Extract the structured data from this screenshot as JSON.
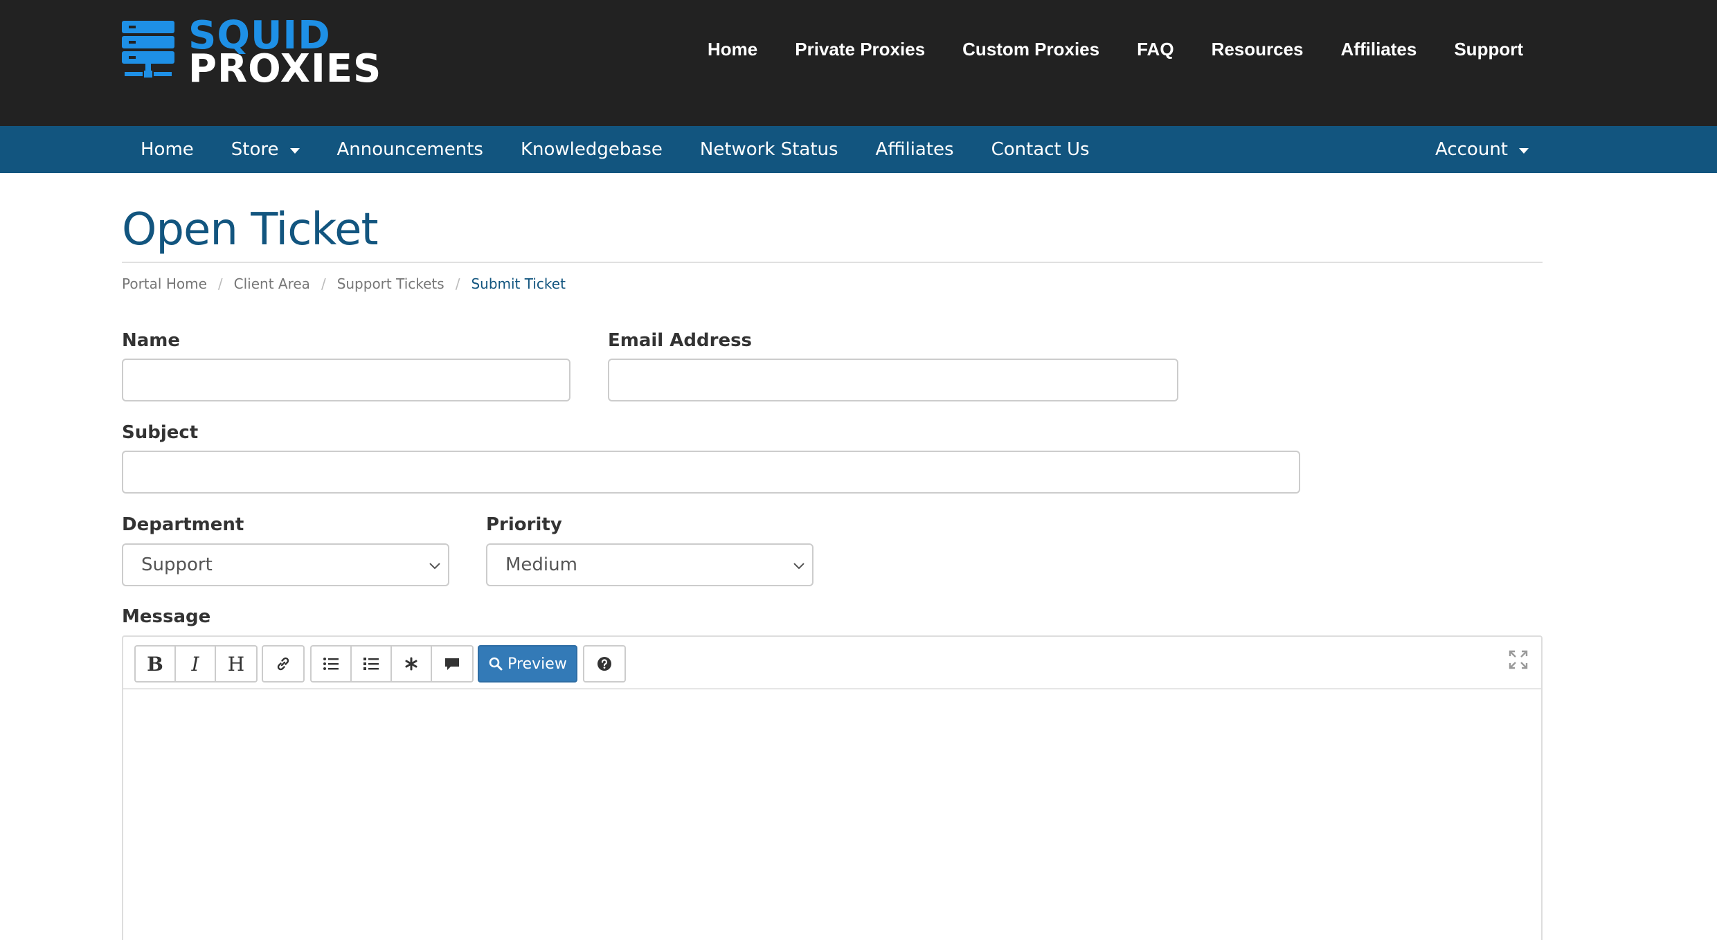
{
  "brand": {
    "line1": "SQUID",
    "line2": "PROXIES",
    "primary_color": "#1e90e6",
    "header_bg": "#222222",
    "nav_bg": "#12557f"
  },
  "top_nav": {
    "items": [
      "Home",
      "Private Proxies",
      "Custom Proxies",
      "FAQ",
      "Resources",
      "Affiliates",
      "Support"
    ]
  },
  "main_nav": {
    "items": [
      "Home",
      "Store",
      "Announcements",
      "Knowledgebase",
      "Network Status",
      "Affiliates",
      "Contact Us"
    ],
    "account": "Account"
  },
  "page": {
    "title": "Open Ticket"
  },
  "breadcrumb": {
    "items": [
      "Portal Home",
      "Client Area",
      "Support Tickets"
    ],
    "active": "Submit Ticket",
    "separator": "/"
  },
  "form": {
    "name_label": "Name",
    "name_value": "",
    "email_label": "Email Address",
    "email_value": "",
    "subject_label": "Subject",
    "subject_value": "",
    "department_label": "Department",
    "department_value": "Support",
    "priority_label": "Priority",
    "priority_value": "Medium",
    "message_label": "Message"
  },
  "editor": {
    "bold": "B",
    "italic": "I",
    "heading": "H",
    "preview_label": "Preview"
  }
}
